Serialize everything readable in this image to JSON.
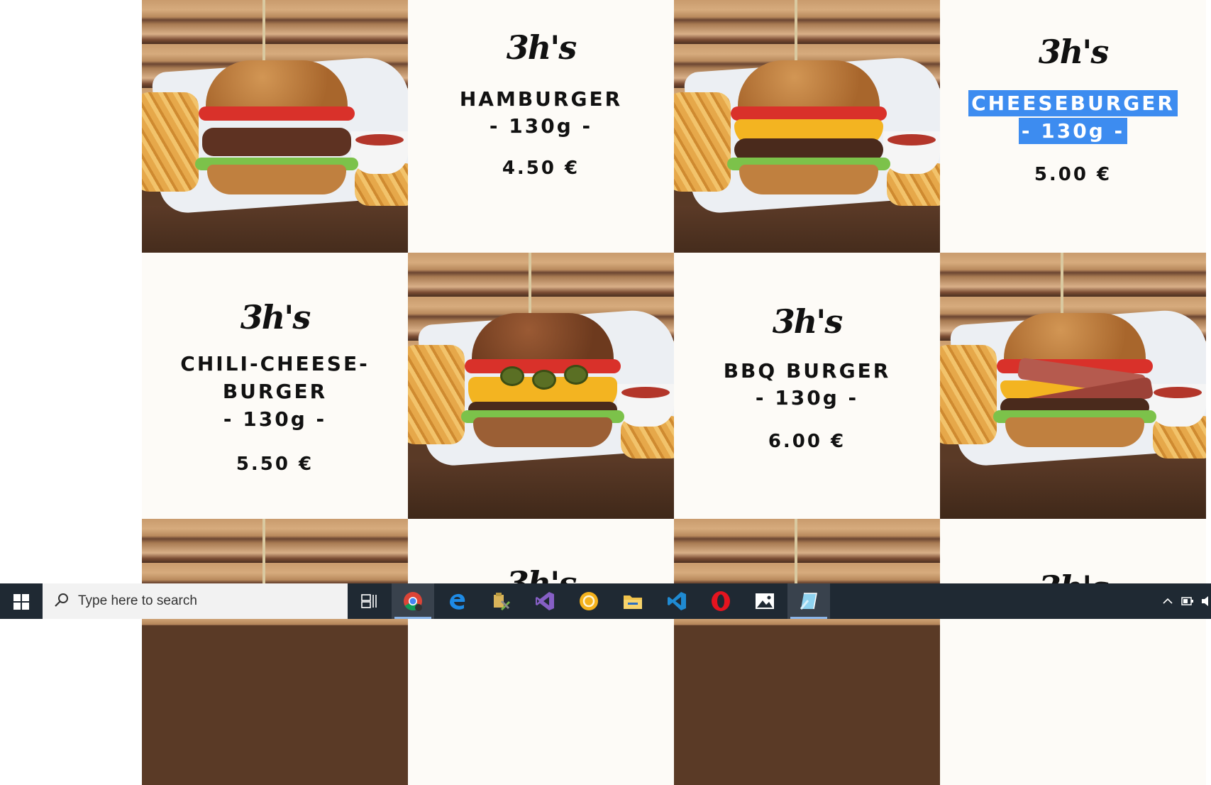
{
  "menu": {
    "tiles": [
      {
        "type": "photo",
        "variant": "classic"
      },
      {
        "type": "text",
        "logo": "3h's",
        "name": "HAMBURGER",
        "weight": "- 130g -",
        "price": "4.50 €"
      },
      {
        "type": "photo",
        "variant": "cheese"
      },
      {
        "type": "text",
        "logo": "3h's",
        "name": "CHEESEBURGER",
        "weight": "- 130g -",
        "price": "5.00 €",
        "selected": true
      },
      {
        "type": "text",
        "logo": "3h's",
        "name_line1": "CHILI-CHEESE-",
        "name_line2": "BURGER",
        "weight": "- 130g -",
        "price": "5.50 €"
      },
      {
        "type": "photo",
        "variant": "chili"
      },
      {
        "type": "text",
        "logo": "3h's",
        "name": "BBQ BURGER",
        "weight": "- 130g -",
        "price": "6.00 €"
      },
      {
        "type": "photo",
        "variant": "bbq"
      },
      {
        "type": "photo",
        "variant": "partial"
      },
      {
        "type": "text",
        "logo": "3h's"
      },
      {
        "type": "photo",
        "variant": "partial"
      },
      {
        "type": "text",
        "logo": "3h's"
      }
    ],
    "selection_color": "#3d8cf0",
    "tile_background": "#fdfbf7"
  },
  "taskbar": {
    "search_placeholder": "Type here to search",
    "icons": [
      "windows-start-icon",
      "search-icon",
      "task-view-icon",
      "chrome-icon",
      "edge-icon",
      "tool-app-icon",
      "visual-studio-icon",
      "yellow-circle-app-icon",
      "file-explorer-icon",
      "vscode-icon",
      "opera-icon",
      "photos-icon",
      "snip-icon"
    ],
    "active_icons": [
      "chrome-icon",
      "snip-icon"
    ],
    "tray_icons": [
      "chevron-up-icon",
      "network-icon",
      "volume-icon"
    ]
  }
}
